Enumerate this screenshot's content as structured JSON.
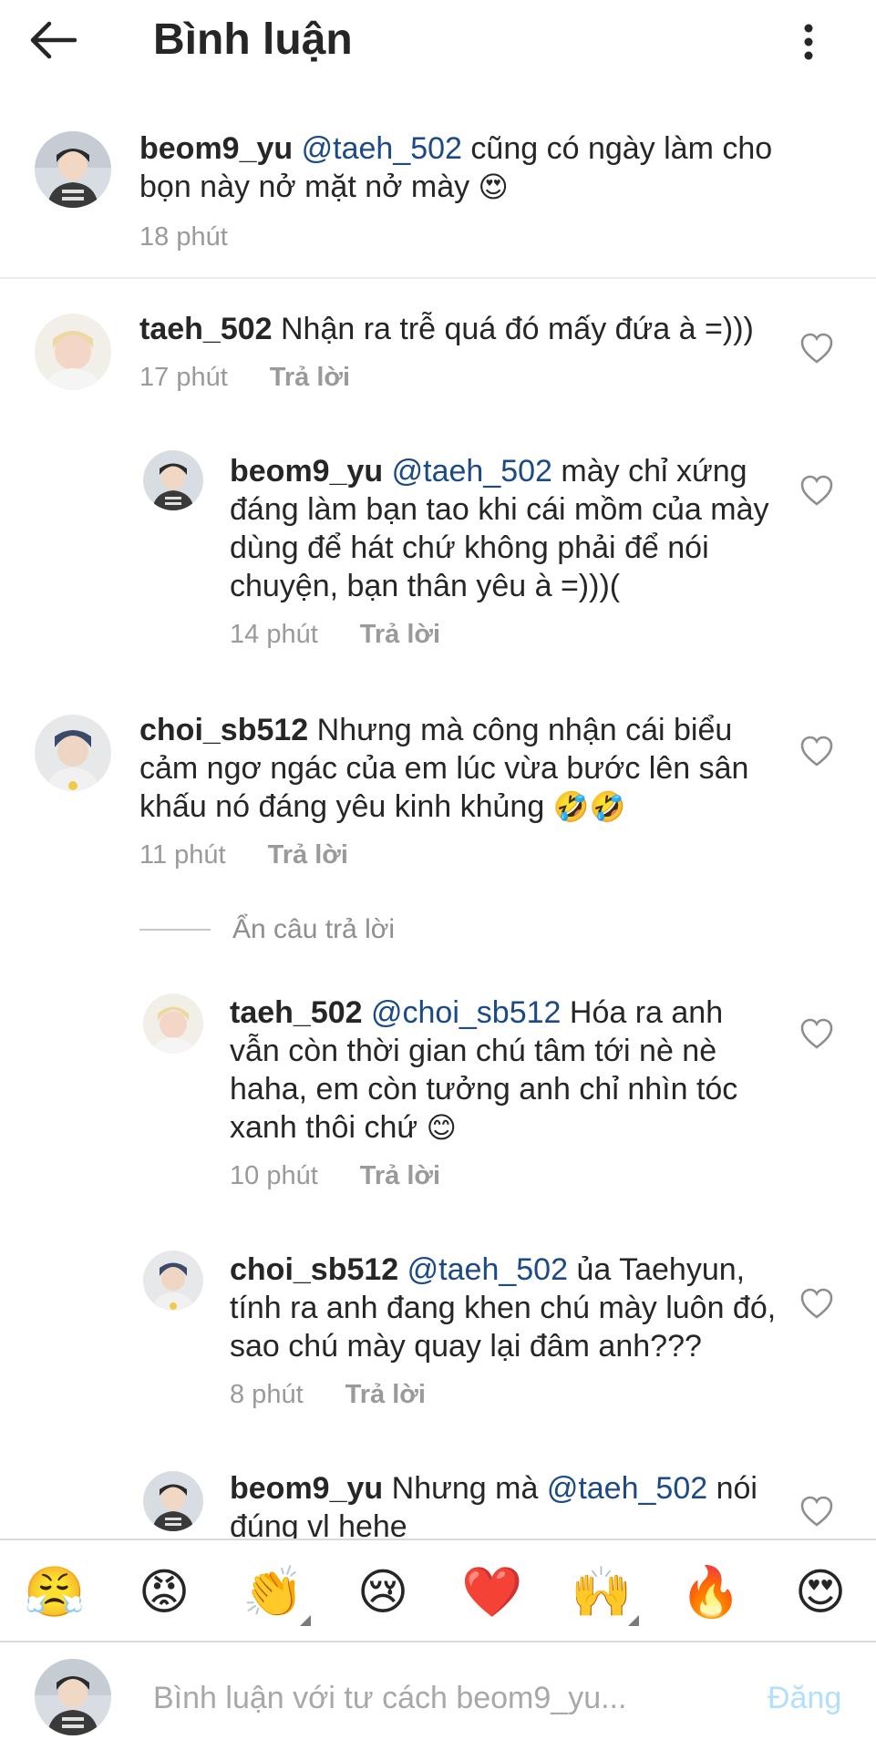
{
  "header": {
    "title": "Bình luận"
  },
  "caption": {
    "username": "beom9_yu",
    "mention": "@taeh_502",
    "text": " cũng có ngày làm cho bọn này nở mặt nở mày ",
    "emoji": "😍",
    "time": "18 phút"
  },
  "comments": [
    {
      "username": "taeh_502",
      "mention": "",
      "text": " Nhận ra trễ quá đó mấy đứa à =)))",
      "emoji": "",
      "time": "17 phút",
      "reply": "Trả lời"
    },
    {
      "username": "beom9_yu",
      "mention": "@taeh_502",
      "text": " mày chỉ xứng đáng làm bạn tao khi cái mồm của mày dùng để hát chứ không phải để nói chuyện, bạn thân yêu à =)))(",
      "emoji": "",
      "time": "14 phút",
      "reply": "Trả lời"
    },
    {
      "username": "choi_sb512",
      "mention": "",
      "text": " Nhưng mà công nhận cái biểu cảm ngơ ngác của em lúc vừa bước lên sân khấu nó đáng yêu kinh khủng ",
      "emoji": "🤣🤣",
      "time": "11 phút",
      "reply": "Trả lời"
    },
    {
      "username": "taeh_502",
      "mention": "@choi_sb512",
      "text": " Hóa ra anh vẫn còn thời gian chú tâm tới nè nè haha, em còn tưởng anh chỉ nhìn tóc xanh thôi chứ ",
      "emoji": "😊",
      "time": "10 phút",
      "reply": "Trả lời"
    },
    {
      "username": "choi_sb512",
      "mention": "@taeh_502",
      "text": " ủa Taehyun, tính ra anh đang khen chú mày luôn đó, sao chú mày quay lại đâm anh???",
      "emoji": "",
      "time": "8 phút",
      "reply": "Trả lời"
    },
    {
      "username": "beom9_yu",
      "text_before": " Nhưng mà ",
      "mention": "@taeh_502",
      "text": " nói đúng vl hehe"
    }
  ],
  "hide_replies": "Ẩn câu trả lời",
  "emoji_bar": [
    "😤",
    "😡",
    "👏",
    "😢",
    "❤️",
    "🙌",
    "🔥",
    "😍"
  ],
  "composer": {
    "placeholder": "Bình luận với tư cách beom9_yu...",
    "post_label": "Đăng"
  }
}
